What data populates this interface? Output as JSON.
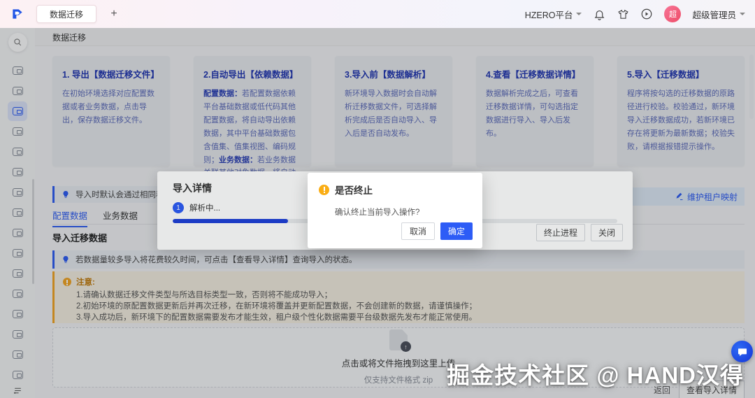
{
  "colors": {
    "accent": "#2d5cf6",
    "card_title_blue": "#2136b4",
    "progress_blue": "#1d3fd8",
    "warning_orange": "#faad14",
    "notice_bg": "#f8f2e4",
    "avatar_pink": "#ee4d68"
  },
  "topbar": {
    "tab": "数据迁移",
    "new_tab": "+",
    "platform": "HZERO平台",
    "user": "超级管理员",
    "avatar_text": "超"
  },
  "page": {
    "title": "数据迁移"
  },
  "sidebar": {
    "active_index": 2,
    "icons": [
      "overview",
      "workflow",
      "data-migration",
      "data-import",
      "data-export",
      "mail-config",
      "report",
      "org-structure",
      "flow-define",
      "form-config",
      "transfer",
      "card-manage",
      "interface",
      "service-link",
      "message-center",
      "rule-engine"
    ]
  },
  "steps": [
    {
      "title": "1. 导出【数据迁移文件】",
      "body": "在初始环境选择对应配置数据或者业务数据，点击导出，保存数据迁移文件。"
    },
    {
      "title": "2.自动导出【依赖数据】",
      "p1_label": "配置数据：",
      "p1_text": "若配置数据依赖平台基础数据或低代码其他配置数据，将自动导出依赖数据，其中平台基础数据包含值集、值集视图、编码规则；",
      "p2_label": "业务数据：",
      "p2_text": "若业务数据关联其他对象数据，将自动导出关联数据。"
    },
    {
      "title": "3.导入前【数据解析】",
      "body": "新环境导入数据时会自动解析迁移数据文件，可选择解析完成后是否自动导入、导入后是否自动发布。"
    },
    {
      "title": "4.查看【迁移数据详情】",
      "body": "数据解析完成之后，可查看迁移数据详情，可勾选指定数据进行导入、导入后发布。"
    },
    {
      "title": "5.导入【迁移数据】",
      "body": "程序将按勾选的迁移数据的原路径进行校验。校验通过，新环境导入迁移数据成功，若新环境已存在将更新为最新数据；校验失败，请根据报错提示操作。"
    }
  ],
  "tips": {
    "tip1": "导入时默认会通过相同租户编码进",
    "tip2": "若数据量较多导入将花费较久时间，可点击【查看导入详情】查询导入的状态。"
  },
  "tabs": {
    "items": [
      "配置数据",
      "业务数据"
    ],
    "active": 0
  },
  "tenant_link": "维护租户映射",
  "section_title": "导入迁移数据",
  "notice": {
    "title": "注意:",
    "items": [
      "1.请确认数据迁移文件类型与所选目标类型一致，否则将不能成功导入；",
      "2.初始环境的原配置数据更新后并再次迁移，在新环境将覆盖并更新配置数据，不会创建新的数据，请谨慎操作；",
      "3.导入成功后，新环境下的配置数据需要发布才能生效，租户级个性化数据需要平台级数据先发布才能正常使用。"
    ]
  },
  "upload": {
    "main": "点击或将文件拖拽到这里上传",
    "sub": "仅支持文件格式 zip"
  },
  "footer": {
    "back": "返回",
    "detail": "查看导入详情"
  },
  "panel": {
    "title": "导入详情",
    "step_no": "1",
    "step_label": "解析中...",
    "progress_pct": 26,
    "stop_btn": "终止进程",
    "close_btn": "关闭"
  },
  "modal": {
    "title": "是否终止",
    "body": "确认终止当前导入操作?",
    "cancel": "取消",
    "ok": "确定"
  },
  "watermark": "掘金技术社区 @ HAND汉得"
}
